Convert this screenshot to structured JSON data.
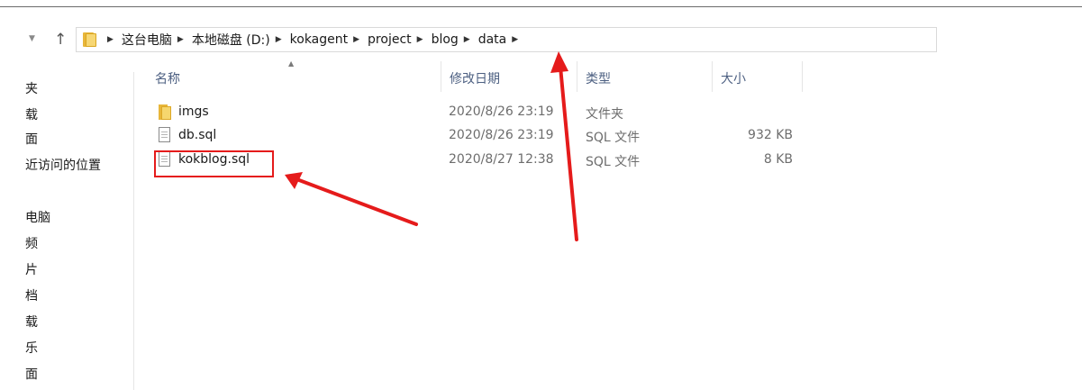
{
  "breadcrumb": {
    "segments": [
      "这台电脑",
      "本地磁盘 (D:)",
      "kokagent",
      "project",
      "blog",
      "data"
    ]
  },
  "sidebar": {
    "items": [
      "夹",
      "载",
      "面",
      "近访问的位置",
      "电脑",
      "频",
      "片",
      "档",
      "载",
      "乐",
      "面"
    ]
  },
  "columns": {
    "name": "名称",
    "date": "修改日期",
    "type": "类型",
    "size": "大小"
  },
  "files": [
    {
      "name": "imgs",
      "date": "2020/8/26 23:19",
      "type": "文件夹",
      "size": "",
      "icon": "folder-icon"
    },
    {
      "name": "db.sql",
      "date": "2020/8/26 23:19",
      "type": "SQL 文件",
      "size": "932 KB",
      "icon": "file-icon"
    },
    {
      "name": "kokblog.sql",
      "date": "2020/8/27 12:38",
      "type": "SQL 文件",
      "size": "8 KB",
      "icon": "file-icon"
    }
  ],
  "annotation_color": "#e51b1b"
}
